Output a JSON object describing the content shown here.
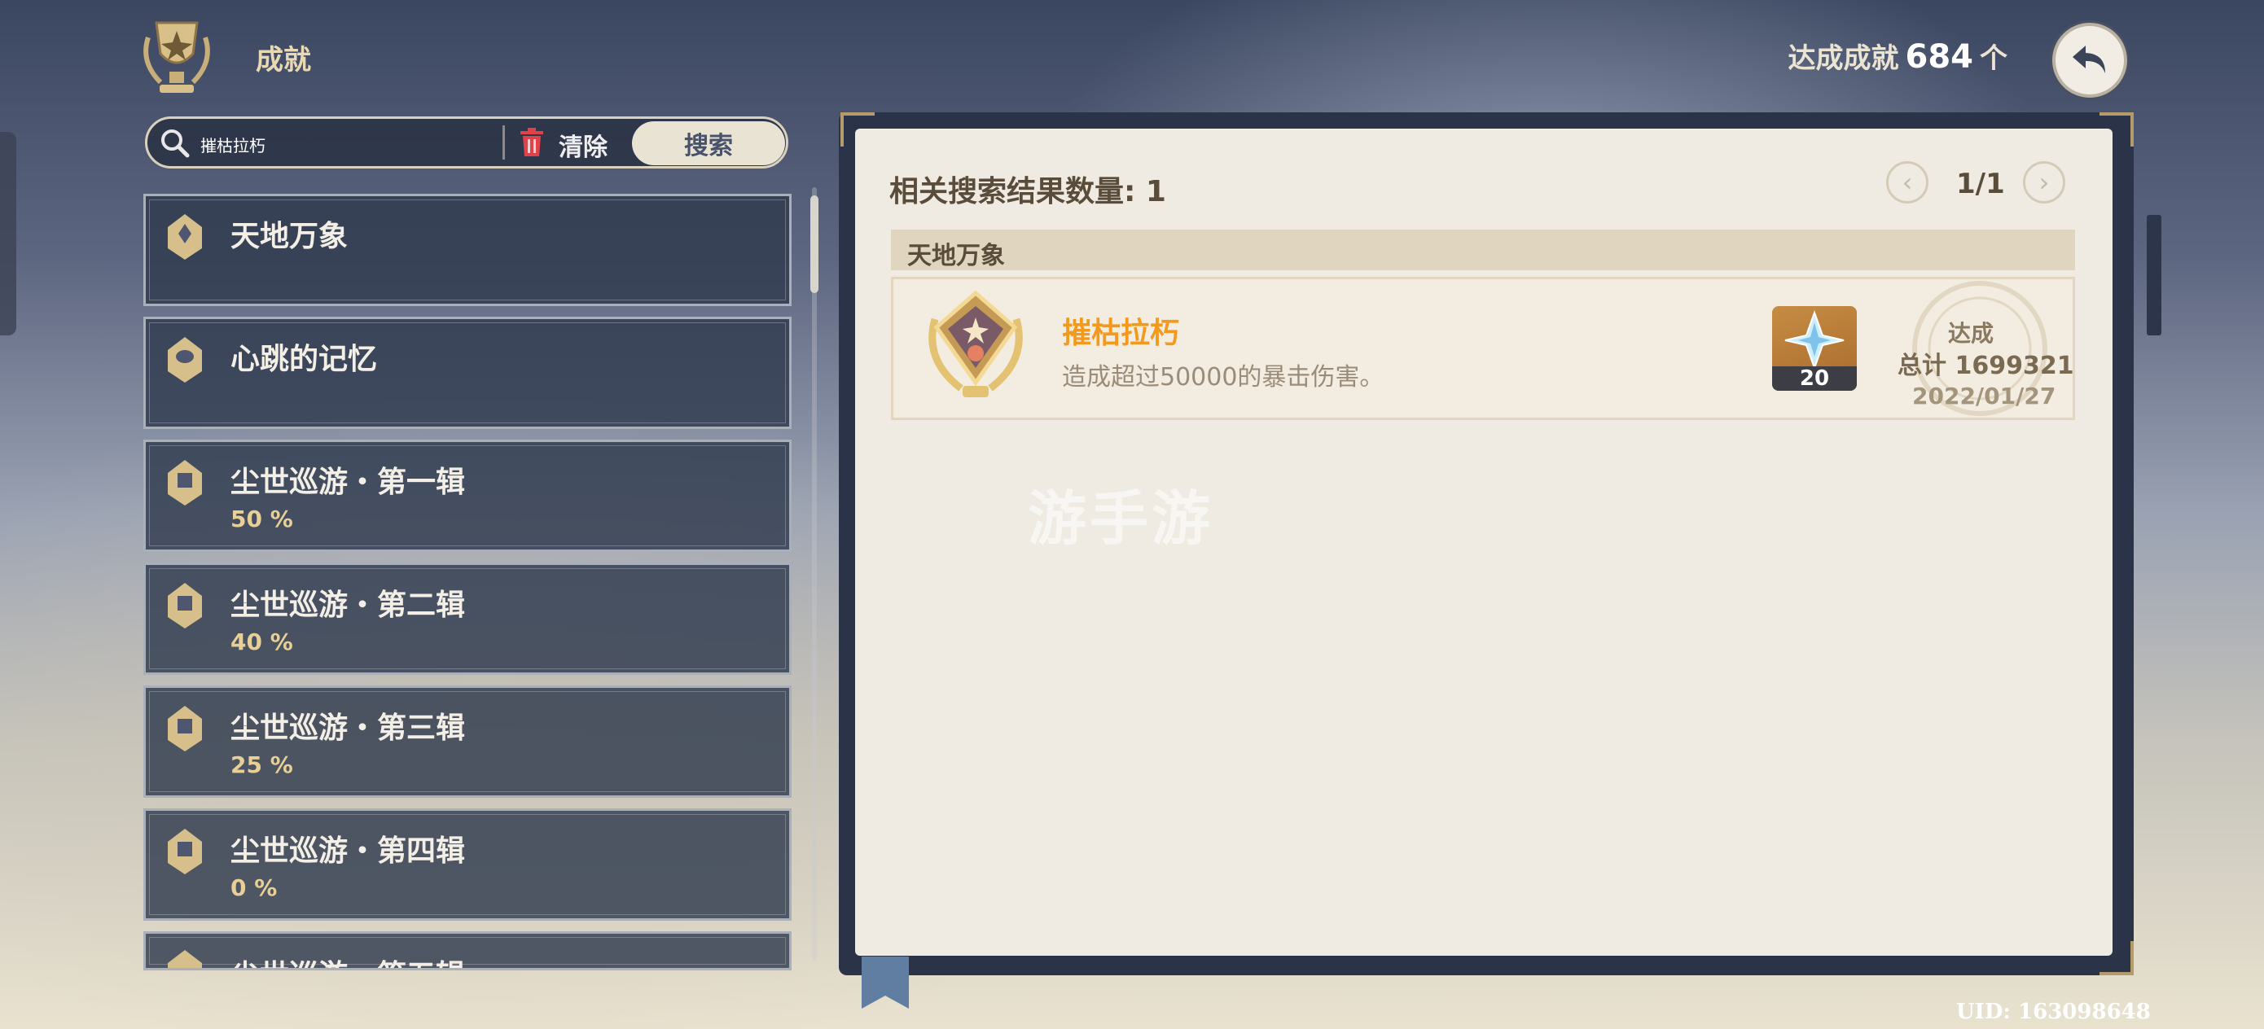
{
  "header": {
    "title": "成就",
    "achieved_label": "达成成就",
    "achieved_count": "684",
    "achieved_unit": "个",
    "back_icon": "back-arrow-icon"
  },
  "search": {
    "value": "摧枯拉朽",
    "clear_label": "清除",
    "search_label": "搜索"
  },
  "sidebar": {
    "items": [
      {
        "name": "天地万象",
        "percent": ""
      },
      {
        "name": "心跳的记忆",
        "percent": ""
      },
      {
        "name": "尘世巡游・第一辑",
        "percent": "50 %"
      },
      {
        "name": "尘世巡游・第二辑",
        "percent": "40 %"
      },
      {
        "name": "尘世巡游・第三辑",
        "percent": "25 %"
      },
      {
        "name": "尘世巡游・第四辑",
        "percent": "0 %"
      },
      {
        "name": "尘世巡游・第五辑",
        "percent": ""
      }
    ]
  },
  "results": {
    "count_label": "相关搜索结果数量: 1",
    "page_indicator": "1/1",
    "group_title": "天地万象",
    "achievement": {
      "name": "摧枯拉朽",
      "description": "造成超过50000的暴击伤害。",
      "reward_amount": "20",
      "status": "达成",
      "total": "总计 1699321",
      "date": "2022/01/27"
    }
  },
  "watermark": "游手游",
  "footer": {
    "uid": "UID: 163098648"
  },
  "colors": {
    "accent_orange": "#f39a1e",
    "panel_dark": "#2a3348",
    "page_bg": "#f0ebe2"
  }
}
